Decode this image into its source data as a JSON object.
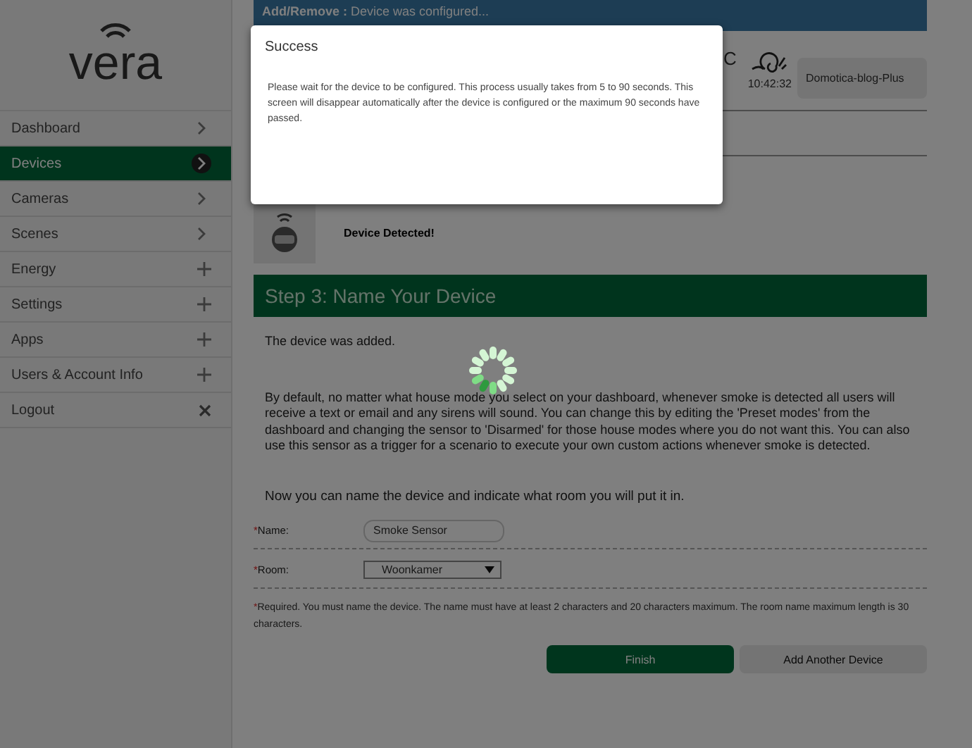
{
  "logo": {
    "text": "vera"
  },
  "sidebar": {
    "items": [
      {
        "label": "Dashboard",
        "kind": "chevron",
        "selected": false
      },
      {
        "label": "Devices",
        "kind": "chevron",
        "selected": true
      },
      {
        "label": "Cameras",
        "kind": "chevron",
        "selected": false
      },
      {
        "label": "Scenes",
        "kind": "chevron",
        "selected": false
      },
      {
        "label": "Energy",
        "kind": "plus",
        "selected": false
      },
      {
        "label": "Settings",
        "kind": "plus",
        "selected": false
      },
      {
        "label": "Apps",
        "kind": "plus",
        "selected": false
      },
      {
        "label": "Users & Account Info",
        "kind": "plus",
        "selected": false
      },
      {
        "label": "Logout",
        "kind": "close",
        "selected": false
      }
    ]
  },
  "banner": {
    "text": "**Add/Remove :** Device was configured..."
  },
  "header": {
    "fragment": "C",
    "time": "10:42:32",
    "account": "Domotica-blog-Plus"
  },
  "detected": {
    "text": "Device Detected!"
  },
  "step": {
    "title": "Step 3: Name Your Device"
  },
  "added": "The device was added.",
  "description": "By default, no matter what house mode you select on your dashboard, whenever smoke is detected all users will receive a text or email and any sirens will sound. You can change this by editing the 'Preset modes' from the dashboard and changing the sensor to 'Disarmed' for those house modes where you do not want this. You can also use this sensor as a trigger for a scenario to execute your own custom actions whenever smoke is detected.",
  "instruction": "Now you can name the device and indicate what room you will put it in.",
  "form": {
    "fields": [
      {
        "kind": "text",
        "required_mark": "*",
        "label": "Name:",
        "value": "Smoke Sensor"
      },
      {
        "kind": "select",
        "required_mark": "*",
        "label": "Room:",
        "value": "Woonkamer"
      }
    ],
    "note_mark": "*",
    "note": "Required. You must name the device. The name must have at least 2 characters and 20 characters maximum. The room name maximum length is 30 characters."
  },
  "buttons": [
    {
      "label": "Finish",
      "kind": "primary"
    },
    {
      "label": "Add Another Device",
      "kind": "secondary"
    }
  ],
  "modal": {
    "title": "Success",
    "message": "Please wait for the device to be configured. This process usually takes from 5 to 90 seconds. This screen will disappear automatically after the device is configured or the maximum 90 seconds have passed."
  }
}
